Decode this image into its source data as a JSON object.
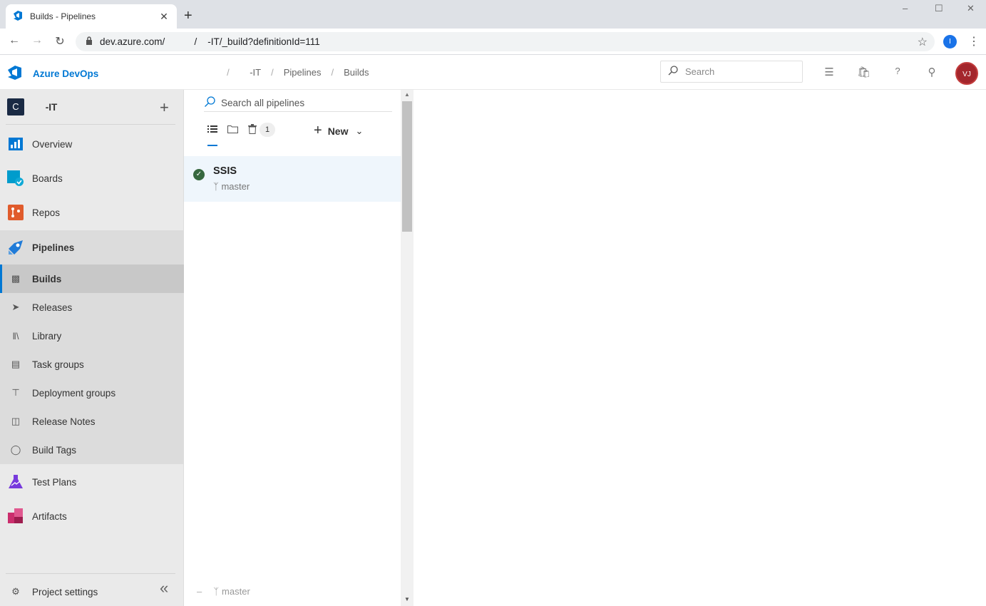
{
  "browser": {
    "tab_title": "Builds - Pipelines",
    "tab_close": "✕",
    "new_tab": "+",
    "url": "dev.azure.com/           /    -IT/_build?definitionId=111",
    "profile_initial": "I",
    "window_controls": [
      "–",
      "☐",
      "✕"
    ]
  },
  "header": {
    "brand": "Azure DevOps",
    "breadcrumbs": [
      "          ",
      "    -IT",
      "Pipelines",
      "Builds"
    ],
    "search_placeholder": "Search",
    "avatar_initials": "VJ"
  },
  "sidebar": {
    "project_badge": "C",
    "project_name": "     -IT",
    "add": "+",
    "items": [
      {
        "label": "Overview",
        "icon": "overview-icon"
      },
      {
        "label": "Boards",
        "icon": "boards-icon"
      },
      {
        "label": "Repos",
        "icon": "repos-icon"
      },
      {
        "label": "Pipelines",
        "icon": "pipelines-icon"
      },
      {
        "label": "Test Plans",
        "icon": "test-plans-icon"
      },
      {
        "label": "Artifacts",
        "icon": "artifacts-icon"
      }
    ],
    "pipelines_sub": [
      {
        "label": "Builds",
        "icon": "builds-icon"
      },
      {
        "label": "Releases",
        "icon": "rocket-icon"
      },
      {
        "label": "Library",
        "icon": "library-icon"
      },
      {
        "label": "Task groups",
        "icon": "task-groups-icon"
      },
      {
        "label": "Deployment groups",
        "icon": "deployment-groups-icon"
      },
      {
        "label": "Release Notes",
        "icon": "package-icon"
      },
      {
        "label": "Build Tags",
        "icon": "tag-icon"
      }
    ],
    "project_settings": "Project settings",
    "collapse": "«"
  },
  "panel": {
    "search_placeholder": "Search all pipelines",
    "deleted_count": "1",
    "new_label": "New",
    "pipelines": [
      {
        "name": "SSIS",
        "branch": "master",
        "status": "succeeded"
      }
    ],
    "bottom_branch": "master"
  },
  "colors": {
    "accent": "#0078d4",
    "avatar": "#a4262c",
    "success": "#37683f"
  }
}
